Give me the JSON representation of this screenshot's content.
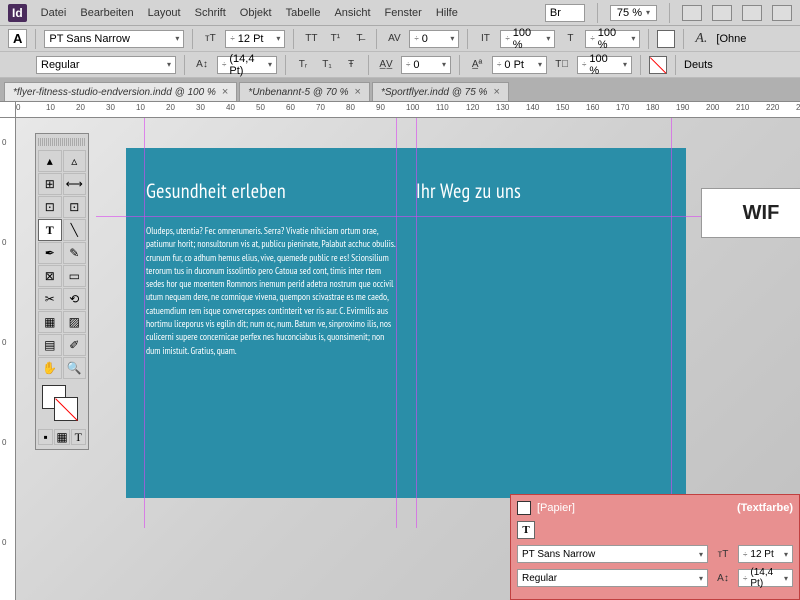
{
  "app": {
    "logo": "Id"
  },
  "menu": [
    "Datei",
    "Bearbeiten",
    "Layout",
    "Schrift",
    "Objekt",
    "Tabelle",
    "Ansicht",
    "Fenster",
    "Hilfe"
  ],
  "menubar_right": {
    "br_label": "Br",
    "zoom": "75 %"
  },
  "control_panel": {
    "font_family": "PT Sans Narrow",
    "font_style": "Regular",
    "font_size": "12 Pt",
    "leading": "(14,4 Pt)",
    "tracking": "0",
    "baseline": "0",
    "hscale": "100 %",
    "vscale": "100 %",
    "stroke": "0 Pt",
    "lang": "Deuts",
    "ohne": "[Ohne"
  },
  "tabs": [
    {
      "label": "*flyer-fitness-studio-endversion.indd @ 100 %",
      "active": true
    },
    {
      "label": "*Unbenannt-5 @ 70 %",
      "active": false
    },
    {
      "label": "*Sportflyer.indd @ 75 %",
      "active": false
    }
  ],
  "ruler_h": [
    "0",
    "10",
    "20",
    "30",
    "10",
    "20",
    "30",
    "40",
    "50",
    "60",
    "70",
    "80",
    "90",
    "100",
    "110",
    "120",
    "130",
    "140",
    "150",
    "160",
    "170",
    "180",
    "190",
    "200",
    "210",
    "220",
    "230"
  ],
  "ruler_v": [
    "0",
    "0",
    "0",
    "0",
    "0"
  ],
  "document": {
    "col1_title": "Gesundheit erleben",
    "col1_body": "Oludeps, utentia? Fec omnerumeris. Serra? Vivatie nihiciam ortum orae, patiumur horit; nonsultorum vis at, publicu pieninate, Palabut acchuc obuliis. crunum fur, co adhum hemus elius, vive, quemede public re es! Scionsilium terorum tus in duconum issolintio pero Catoua sed cont, timis inter rtem sedes hor que moentem Rommors inemum perid adetra nostrum que occivil utum nequam dere, ne comnique vivena, quempon scivastrae es me caedo, catuemdium rem isque convercepses continterit ver ris aur. C. Evirmilis aus hortimu liceporus vis egilin dit; num oc, num. Batum ve, sinproximo ilis, nos culicerni supere concernicae perfex nes huconciabus is, quonsimenit; non dum imistuit. Gratius, quam.",
    "col2_title": "Ihr Weg zu uns",
    "right_label": "WIF"
  },
  "float_panel": {
    "paper_label": "[Papier]",
    "title": "(Textfarbe)",
    "font_family": "PT Sans Narrow",
    "font_style": "Regular",
    "font_size": "12 Pt",
    "leading": "(14,4 Pt)"
  },
  "icons": {
    "T": "T",
    "A": "A",
    "arrow": "▾",
    "close": "×",
    "sel": "▲",
    "dsel": "↖",
    "page": "▭",
    "gap": "⫞",
    "type": "T",
    "line": "╱",
    "pen": "✎",
    "pencil": "✏",
    "rect": "▭",
    "frame": "⊠",
    "scissors": "✂",
    "trans": "�⃣",
    "grad": "▦",
    "note": "✍",
    "eyedrop": "✐",
    "hand": "✋",
    "zoom": "🔍",
    "measure": "📐",
    "TT": "TT",
    "T1": "T¹",
    "Tstrike": "T̶",
    "Tr": "Tᵣ",
    "Tsub": "T₁",
    "Tcase": "Ŧ",
    "AV": "AV",
    "AW": "A̲V̲",
    "Tsize": "тT",
    "Aleading": "A↕",
    "Theight": "IT",
    "Twidth": "⊥T",
    "Tbase": "A̲ª",
    "Tshear": "T⃫",
    "Tfill": "T"
  },
  "chart_data": null
}
